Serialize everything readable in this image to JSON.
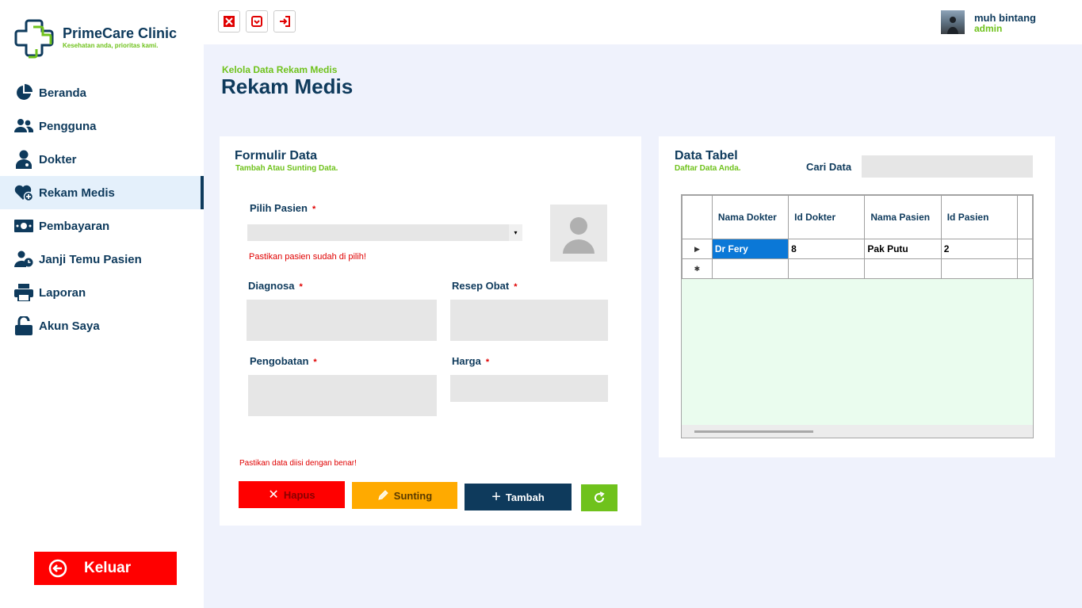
{
  "brand": {
    "name": "PrimeCare Clinic",
    "tagline": "Kesehatan anda, prioritas kami.",
    "primary_color": "#0e3a5c",
    "accent_color": "#6fc21c"
  },
  "sidebar": {
    "items": [
      {
        "label": "Beranda",
        "icon": "pie-chart-icon",
        "active": false
      },
      {
        "label": "Pengguna",
        "icon": "users-icon",
        "active": false
      },
      {
        "label": "Dokter",
        "icon": "doctor-icon",
        "active": false
      },
      {
        "label": "Rekam Medis",
        "icon": "heart-plus-icon",
        "active": true
      },
      {
        "label": "Pembayaran",
        "icon": "money-icon",
        "active": false
      },
      {
        "label": "Janji Temu Pasien",
        "icon": "user-clock-icon",
        "active": false
      },
      {
        "label": "Laporan",
        "icon": "printer-icon",
        "active": false
      },
      {
        "label": "Akun Saya",
        "icon": "unlock-icon",
        "active": false
      }
    ],
    "logout_label": "Keluar"
  },
  "topbar": {
    "buttons": [
      "maximize-icon",
      "minimize-icon",
      "exit-icon"
    ],
    "user_name": "muh bintang",
    "user_role": "admin"
  },
  "header": {
    "subtitle": "Kelola Data Rekam Medis",
    "title": "Rekam Medis"
  },
  "form": {
    "title": "Formulir Data",
    "subtitle": "Tambah Atau Sunting Data.",
    "patient_label": "Pilih Pasien",
    "patient_value": "",
    "patient_error": "Pastikan pasien sudah di pilih!",
    "diagnosis_label": "Diagnosa",
    "prescription_label": "Resep Obat",
    "treatment_label": "Pengobatan",
    "price_label": "Harga",
    "required_mark": "*",
    "form_error": "Pastikan data diisi dengan benar!",
    "buttons": {
      "delete": "Hapus",
      "edit": "Sunting",
      "add": "Tambah"
    }
  },
  "table": {
    "title": "Data Tabel",
    "subtitle": "Daftar Data Anda.",
    "search_label": "Cari Data",
    "search_value": "",
    "columns": [
      "Nama Dokter",
      "Id Dokter",
      "Nama Pasien",
      "Id Pasien"
    ],
    "rows": [
      [
        "Dr Fery",
        "8",
        "Pak Putu",
        "2"
      ],
      [
        "",
        "",
        "",
        ""
      ]
    ]
  }
}
